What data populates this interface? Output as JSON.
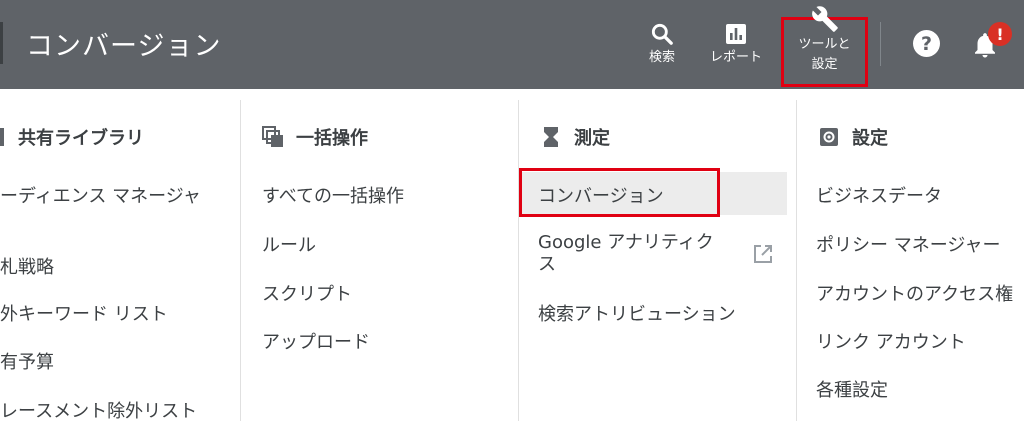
{
  "header": {
    "title": "コンバージョン",
    "search_label": "検索",
    "report_label": "レポート",
    "tools_label_line1": "ツールと",
    "tools_label_line2": "設定",
    "help_glyph": "?",
    "notification_badge": "!"
  },
  "columns": {
    "shared_library": {
      "heading": "共有ライブラリ",
      "items": [
        "ーディエンス マネージャ",
        "札戦略",
        "外キーワード リスト",
        "有予算",
        "レースメント除外リスト"
      ]
    },
    "bulk_actions": {
      "heading": "一括操作",
      "items": [
        "すべての一括操作",
        "ルール",
        "スクリプト",
        "アップロード"
      ]
    },
    "measurement": {
      "heading": "測定",
      "items": [
        "コンバージョン",
        "Google アナリティク",
        "ス",
        "検索アトリビューション"
      ]
    },
    "settings": {
      "heading": "設定",
      "items": [
        "ビジネスデータ",
        "ポリシー マネージャー",
        "アカウントのアクセス権",
        "リンク アカウント",
        "各種設定"
      ]
    }
  },
  "colors": {
    "topbar": "#5f6368",
    "highlight_border": "#e00012",
    "selected_row": "#ececec",
    "badge": "#d93025"
  },
  "icons": [
    "search-icon",
    "bar-chart-icon",
    "wrench-icon",
    "help-icon",
    "bell-icon",
    "library-icon",
    "layers-icon",
    "hourglass-icon",
    "gear-icon",
    "external-link-icon"
  ]
}
